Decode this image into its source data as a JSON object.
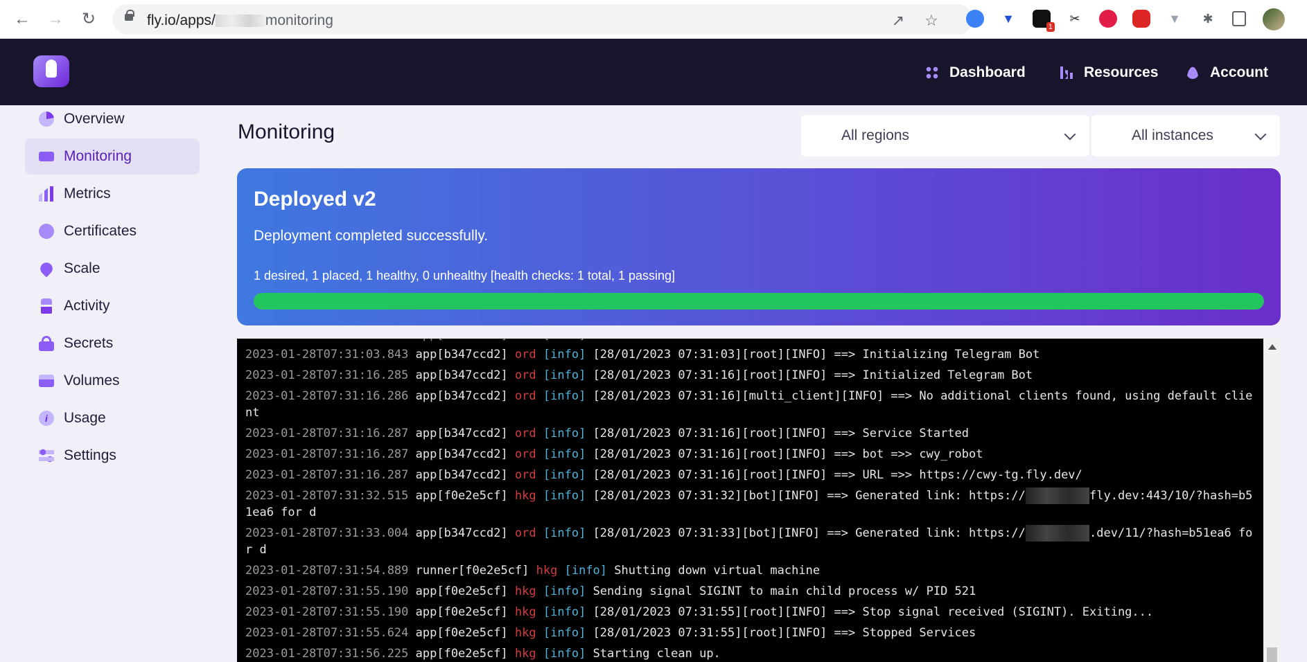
{
  "browser": {
    "url_prefix": "fly.io/apps/",
    "url_suffix": "monitoring",
    "notification_badge": "1"
  },
  "header": {
    "nav": [
      "Dashboard",
      "Resources",
      "Account"
    ]
  },
  "sidebar": {
    "items": [
      {
        "label": "Overview",
        "icon": "overview-icon"
      },
      {
        "label": "Monitoring",
        "icon": "monitor-icon",
        "active": true
      },
      {
        "label": "Metrics",
        "icon": "bar-chart-icon"
      },
      {
        "label": "Certificates",
        "icon": "badge-check-icon"
      },
      {
        "label": "Scale",
        "icon": "scale-icon"
      },
      {
        "label": "Activity",
        "icon": "activity-icon"
      },
      {
        "label": "Secrets",
        "icon": "lock-icon"
      },
      {
        "label": "Volumes",
        "icon": "volume-icon"
      },
      {
        "label": "Usage",
        "icon": "info-icon"
      },
      {
        "label": "Settings",
        "icon": "settings-icon"
      }
    ]
  },
  "main": {
    "title": "Monitoring",
    "region_select": "All regions",
    "instance_select": "All instances"
  },
  "deploy": {
    "title": "Deployed v2",
    "description": "Deployment completed successfully.",
    "stats": "1 desired, 1 placed, 1 healthy, 0 unhealthy [health checks: 1 total, 1 passing]",
    "progress_percent": 100,
    "colors": {
      "progress": "#22c55e",
      "gradient_start": "#3f78df",
      "gradient_end": "#6a2fc9"
    }
  },
  "logs": [
    {
      "ts": "2023-01-28T07:31:03.843",
      "src": "app[b347ccd2]",
      "region": "ord",
      "level": "[info]",
      "msg": "[28/01/2023 07:31:03][root][INFO] ==> Initializing Telegram Bot"
    },
    {
      "ts": "2023-01-28T07:31:16.285",
      "src": "app[b347ccd2]",
      "region": "ord",
      "level": "[info]",
      "msg": "[28/01/2023 07:31:16][root][INFO] ==> Initialized Telegram Bot"
    },
    {
      "ts": "2023-01-28T07:31:16.286",
      "src": "app[b347ccd2]",
      "region": "ord",
      "level": "[info]",
      "msg": "[28/01/2023 07:31:16][multi_client][INFO] ==> No additional clients found, using default client"
    },
    {
      "ts": "2023-01-28T07:31:16.287",
      "src": "app[b347ccd2]",
      "region": "ord",
      "level": "[info]",
      "msg": "[28/01/2023 07:31:16][root][INFO] ==> Service Started"
    },
    {
      "ts": "2023-01-28T07:31:16.287",
      "src": "app[b347ccd2]",
      "region": "ord",
      "level": "[info]",
      "msg": "[28/01/2023 07:31:16][root][INFO] ==> bot =>> cwy_robot"
    },
    {
      "ts": "2023-01-28T07:31:16.287",
      "src": "app[b347ccd2]",
      "region": "ord",
      "level": "[info]",
      "msg": "[28/01/2023 07:31:16][root][INFO] ==> URL =>> https://cwy-tg.fly.dev/"
    },
    {
      "ts": "2023-01-28T07:31:32.515",
      "src": "app[f0e2e5cf]",
      "region": "hkg",
      "level": "[info]",
      "msg": "[28/01/2023 07:31:32][bot][INFO] ==> Generated link: https://",
      "masked": true,
      "msg2": "fly.dev:443/10/?hash=b51ea6 for d"
    },
    {
      "ts": "2023-01-28T07:31:33.004",
      "src": "app[b347ccd2]",
      "region": "ord",
      "level": "[info]",
      "msg": "[28/01/2023 07:31:33][bot][INFO] ==> Generated link: https://",
      "masked": true,
      "msg2": ".dev/11/?hash=b51ea6 for d"
    },
    {
      "ts": "2023-01-28T07:31:54.889",
      "src": "runner[f0e2e5cf]",
      "region": "hkg",
      "level": "[info]",
      "msg": "Shutting down virtual machine"
    },
    {
      "ts": "2023-01-28T07:31:55.190",
      "src": "app[f0e2e5cf]",
      "region": "hkg",
      "level": "[info]",
      "msg": "Sending signal SIGINT to main child process w/ PID 521"
    },
    {
      "ts": "2023-01-28T07:31:55.190",
      "src": "app[f0e2e5cf]",
      "region": "hkg",
      "level": "[info]",
      "msg": "[28/01/2023 07:31:55][root][INFO] ==> Stop signal received (SIGINT). Exiting..."
    },
    {
      "ts": "2023-01-28T07:31:55.624",
      "src": "app[f0e2e5cf]",
      "region": "hkg",
      "level": "[info]",
      "msg": "[28/01/2023 07:31:55][root][INFO] ==> Stopped Services"
    },
    {
      "ts": "2023-01-28T07:31:56.225",
      "src": "app[f0e2e5cf]",
      "region": "hkg",
      "level": "[info]",
      "msg": "Starting clean up."
    }
  ]
}
